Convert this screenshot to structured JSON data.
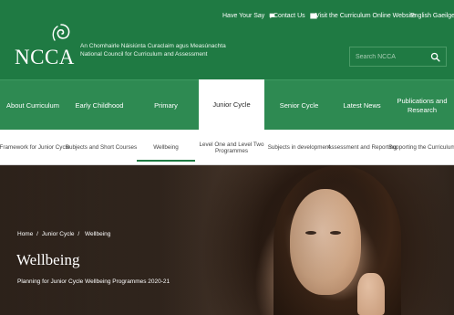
{
  "header": {
    "top_links": [
      {
        "label": "Have Your Say",
        "icon": "chat-bubble-icon"
      },
      {
        "label": "Contact Us",
        "icon": "envelope-icon"
      },
      {
        "label": "Visit the Curriculum Online Website"
      },
      {
        "label": "English  Gaeilge"
      }
    ],
    "logo_text": "NCCA",
    "org_name_irish": "An Chomhairle Náisiúnta Curaclaim agus Measúnachta",
    "org_name_english": "National Council for Curriculum and Assessment",
    "search": {
      "placeholder": "Search NCCA"
    }
  },
  "main_nav": {
    "items": [
      {
        "label": "About Curriculum"
      },
      {
        "label": "Early Childhood"
      },
      {
        "label": "Primary"
      },
      {
        "label": "Junior Cycle",
        "active": true
      },
      {
        "label": "Senior Cycle"
      },
      {
        "label": "Latest News"
      },
      {
        "label": "Publications and Research"
      }
    ]
  },
  "sub_nav": {
    "items": [
      {
        "label": "Framework for Junior Cycle"
      },
      {
        "label": "Subjects and Short Courses"
      },
      {
        "label": "Wellbeing",
        "active": true
      },
      {
        "label": "Level One and Level Two Programmes"
      },
      {
        "label": "Subjects in development"
      },
      {
        "label": "Assessment and Reporting"
      },
      {
        "label": "Supporting the Curriculum"
      }
    ]
  },
  "hero": {
    "breadcrumb": [
      "Home",
      "Junior Cycle",
      "Wellbeing"
    ],
    "breadcrumb_separator": "/",
    "title": "Wellbeing",
    "subtitle": "Planning for Junior Cycle Wellbeing Programmes 2020-21"
  },
  "colors": {
    "header_green": "#1f7a43",
    "nav_green": "#2e8a52",
    "active_underline": "#1f7a43"
  }
}
